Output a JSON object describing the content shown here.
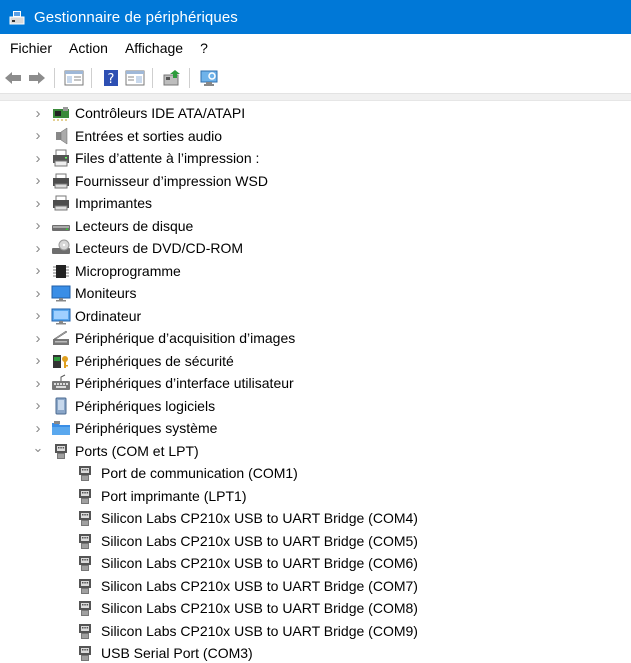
{
  "window": {
    "title": "Gestionnaire de périphériques"
  },
  "menu": {
    "items": [
      "Fichier",
      "Action",
      "Affichage",
      "?"
    ]
  },
  "toolbar": {
    "buttons": [
      "back-icon",
      "forward-icon",
      "show-hide-console-tree-icon",
      "help-icon",
      "properties-icon",
      "update-driver-icon",
      "scan-hardware-icon"
    ]
  },
  "tree": {
    "categories": [
      {
        "label": "Contrôleurs IDE ATA/ATAPI",
        "icon": "ide-controller-icon",
        "expanded": false
      },
      {
        "label": "Entrées et sorties audio",
        "icon": "speaker-icon",
        "expanded": false
      },
      {
        "label": "Files d’attente à l’impression :",
        "icon": "print-queue-icon",
        "expanded": false
      },
      {
        "label": "Fournisseur d’impression WSD",
        "icon": "printer-icon",
        "expanded": false
      },
      {
        "label": "Imprimantes",
        "icon": "printer-icon",
        "expanded": false
      },
      {
        "label": "Lecteurs de disque",
        "icon": "disk-drive-icon",
        "expanded": false
      },
      {
        "label": "Lecteurs de DVD/CD-ROM",
        "icon": "dvd-drive-icon",
        "expanded": false
      },
      {
        "label": "Microprogramme",
        "icon": "firmware-chip-icon",
        "expanded": false
      },
      {
        "label": "Moniteurs",
        "icon": "monitor-icon",
        "expanded": false
      },
      {
        "label": "Ordinateur",
        "icon": "computer-icon",
        "expanded": false
      },
      {
        "label": "Périphérique d’acquisition d’images",
        "icon": "scanner-icon",
        "expanded": false
      },
      {
        "label": "Périphériques de sécurité",
        "icon": "security-key-icon",
        "expanded": false
      },
      {
        "label": "Périphériques d’interface utilisateur",
        "icon": "hid-keyboard-icon",
        "expanded": false
      },
      {
        "label": "Périphériques logiciels",
        "icon": "software-device-icon",
        "expanded": false
      },
      {
        "label": "Périphériques système",
        "icon": "system-folder-icon",
        "expanded": false
      },
      {
        "label": "Ports (COM et LPT)",
        "icon": "port-icon",
        "expanded": true,
        "children": [
          {
            "label": "Port de communication (COM1)",
            "icon": "port-icon"
          },
          {
            "label": "Port imprimante (LPT1)",
            "icon": "port-icon"
          },
          {
            "label": "Silicon Labs CP210x USB to UART Bridge (COM4)",
            "icon": "port-icon"
          },
          {
            "label": "Silicon Labs CP210x USB to UART Bridge (COM5)",
            "icon": "port-icon"
          },
          {
            "label": "Silicon Labs CP210x USB to UART Bridge (COM6)",
            "icon": "port-icon"
          },
          {
            "label": "Silicon Labs CP210x USB to UART Bridge (COM7)",
            "icon": "port-icon"
          },
          {
            "label": "Silicon Labs CP210x USB to UART Bridge (COM8)",
            "icon": "port-icon"
          },
          {
            "label": "Silicon Labs CP210x USB to UART Bridge (COM9)",
            "icon": "port-icon"
          },
          {
            "label": "USB Serial Port (COM3)",
            "icon": "port-icon"
          }
        ]
      }
    ]
  },
  "colors": {
    "titlebar": "#0078d7",
    "title_text": "#ffffff",
    "expander": "#8a8a8a"
  }
}
